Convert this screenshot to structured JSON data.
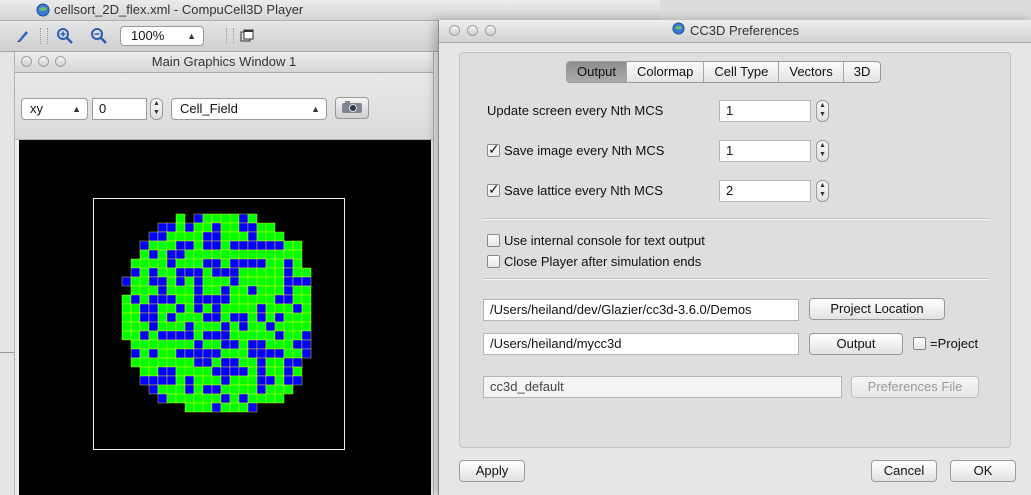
{
  "player": {
    "title": "cellsort_2D_flex.xml - CompuCell3D Player",
    "zoom": "100%",
    "graphics_window": {
      "title": "Main Graphics Window 1",
      "plane": "xy",
      "position": "0",
      "field": "Cell_Field"
    },
    "lattice": {
      "colors": {
        "background": "#000000",
        "cell_a": "#00ff00",
        "cell_b": "#0000ff",
        "border": "#ffff00",
        "box": "#f0f0f0"
      }
    }
  },
  "prefs": {
    "title": "CC3D Preferences",
    "tabs": [
      "Output",
      "Colormap",
      "Cell Type",
      "Vectors",
      "3D"
    ],
    "active_tab": "Output",
    "update_screen": {
      "label": "Update screen every Nth MCS",
      "value": "1"
    },
    "save_image": {
      "label": "Save image every Nth MCS",
      "value": "1",
      "checked": true
    },
    "save_lattice": {
      "label": "Save lattice every Nth MCS",
      "value": "2",
      "checked": true
    },
    "internal_console": {
      "label": "Use internal console for text output",
      "checked": false
    },
    "close_player": {
      "label": "Close Player after simulation ends",
      "checked": false
    },
    "project_location": {
      "value": "/Users/heiland/dev/Glazier/cc3d-3.6.0/Demos",
      "button": "Project Location"
    },
    "output": {
      "value": "/Users/heiland/mycc3d",
      "button": "Output",
      "checkbox_label": "=Project",
      "checked": false
    },
    "preferences_file": {
      "value": "cc3d_default",
      "button": "Preferences File"
    },
    "buttons": {
      "apply": "Apply",
      "cancel": "Cancel",
      "ok": "OK"
    }
  }
}
